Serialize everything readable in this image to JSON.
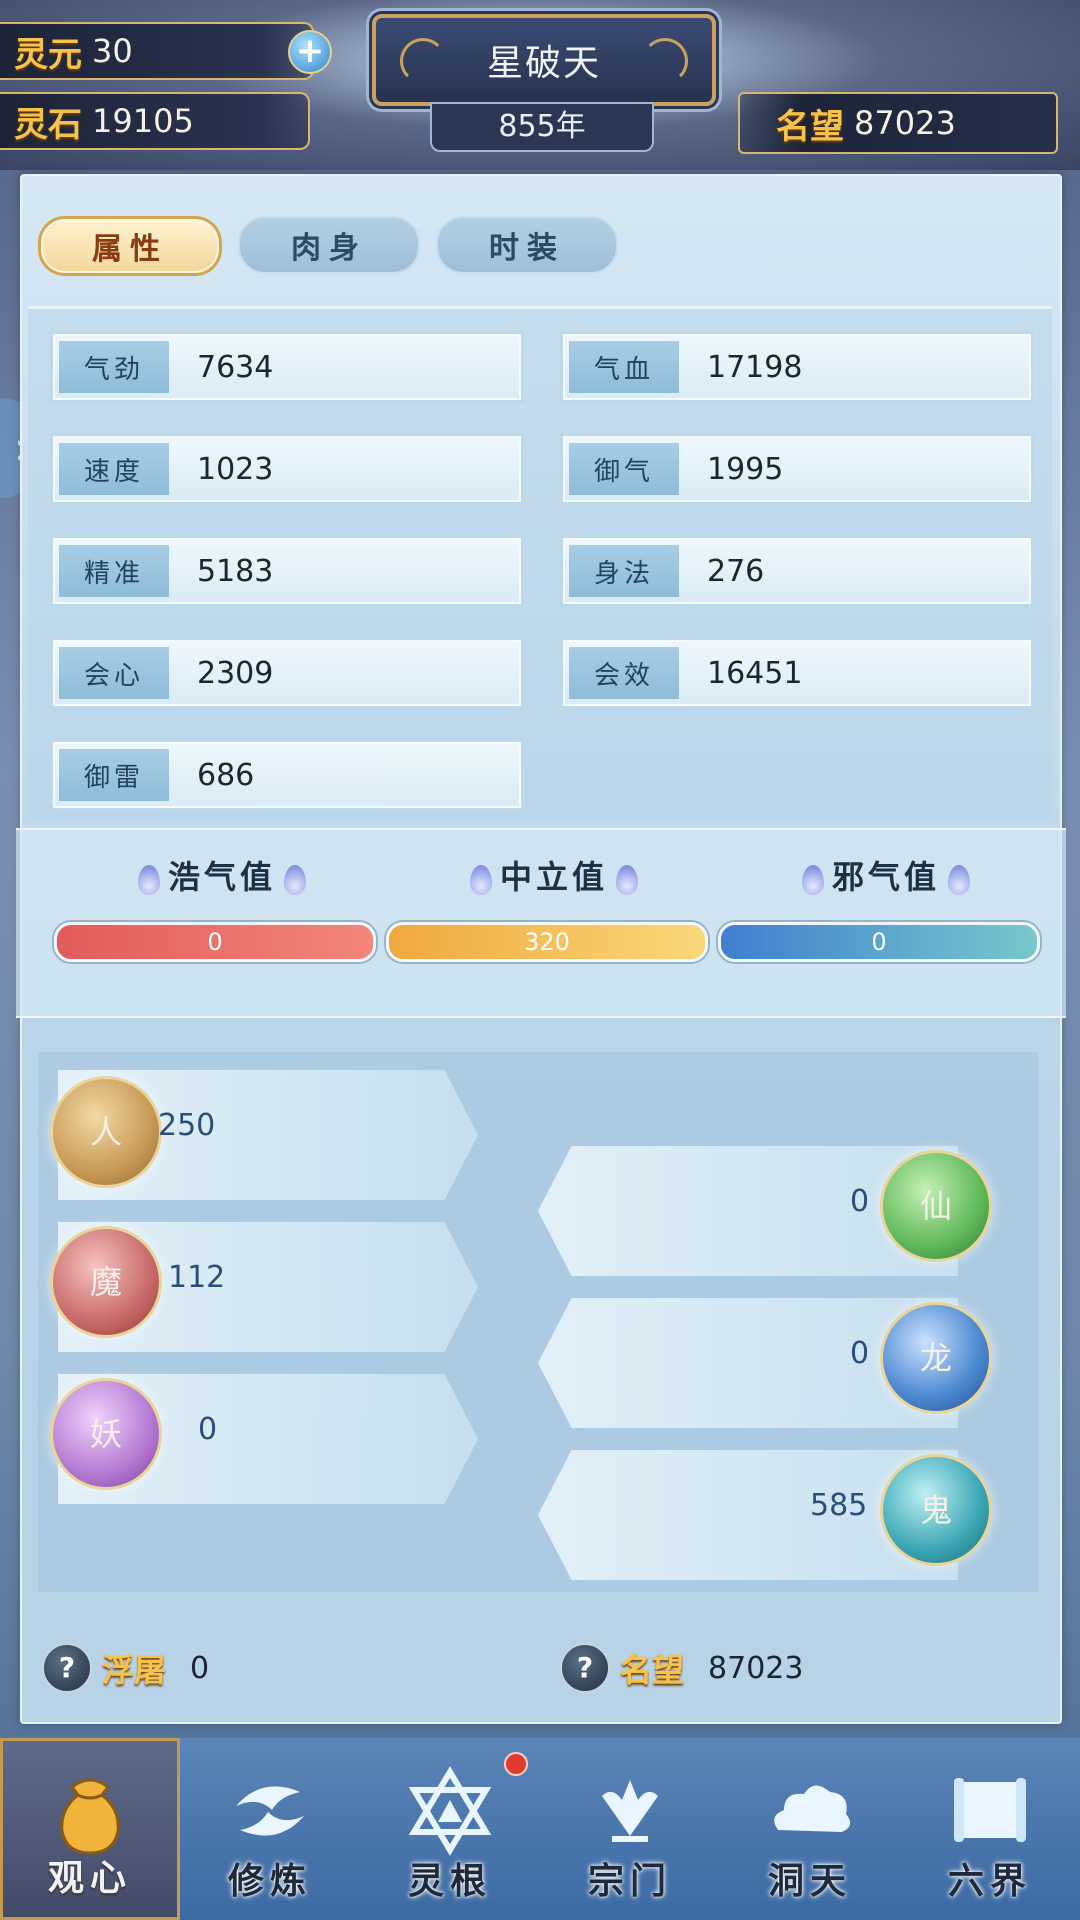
{
  "top": {
    "lingyuan_label": "灵元",
    "lingyuan_value": "30",
    "lingshi_label": "灵石",
    "lingshi_value": "19105",
    "title": "星破天",
    "year": "855年",
    "fame_label": "名望",
    "fame_value": "87023"
  },
  "tabs": [
    "属性",
    "肉身",
    "时装"
  ],
  "active_tab": "属性",
  "attributes": [
    {
      "label": "气劲",
      "value": "7634"
    },
    {
      "label": "气血",
      "value": "17198"
    },
    {
      "label": "速度",
      "value": "1023"
    },
    {
      "label": "御气",
      "value": "1995"
    },
    {
      "label": "精准",
      "value": "5183"
    },
    {
      "label": "身法",
      "value": "276"
    },
    {
      "label": "会心",
      "value": "2309"
    },
    {
      "label": "会效",
      "value": "16451"
    },
    {
      "label": "御雷",
      "value": "686"
    }
  ],
  "morality": [
    {
      "label": "浩气值",
      "value": "0",
      "color": "#e76565"
    },
    {
      "label": "中立值",
      "value": "320",
      "color": "#f2b34a"
    },
    {
      "label": "邪气值",
      "value": "0",
      "color": "#4f8fd0"
    }
  ],
  "realms_left": [
    {
      "orb": "人",
      "value": "250",
      "color": "#c89a55"
    },
    {
      "orb": "魔",
      "value": "112",
      "color": "#c86a6a"
    },
    {
      "orb": "妖",
      "value": "0",
      "color": "#b47ad2"
    }
  ],
  "realms_right": [
    {
      "orb": "仙",
      "value": "0",
      "color": "#5fb85a"
    },
    {
      "orb": "龙",
      "value": "0",
      "color": "#4a86cf"
    },
    {
      "orb": "鬼",
      "value": "585",
      "color": "#3aa6b4"
    }
  ],
  "bottom": {
    "fotu_label": "浮屠",
    "fotu_value": "0",
    "fame_label": "名望",
    "fame_value": "87023"
  },
  "nav": [
    "观心",
    "修炼",
    "灵根",
    "宗门",
    "洞天",
    "六界"
  ],
  "nav_active": "观心"
}
